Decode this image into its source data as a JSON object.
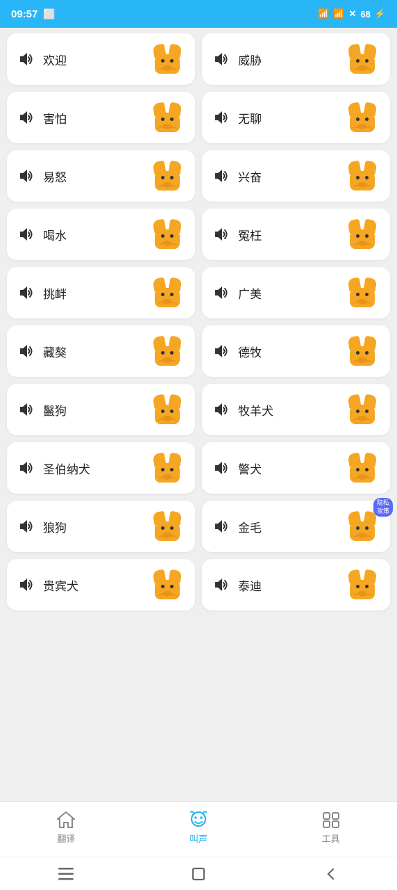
{
  "statusBar": {
    "time": "09:57",
    "icons": [
      "battery",
      "wifi",
      "signal"
    ]
  },
  "cards": [
    {
      "id": 1,
      "label": "欢迎"
    },
    {
      "id": 2,
      "label": "威胁"
    },
    {
      "id": 3,
      "label": "害怕"
    },
    {
      "id": 4,
      "label": "无聊"
    },
    {
      "id": 5,
      "label": "易怒"
    },
    {
      "id": 6,
      "label": "兴奋"
    },
    {
      "id": 7,
      "label": "喝水"
    },
    {
      "id": 8,
      "label": "冤枉"
    },
    {
      "id": 9,
      "label": "挑衅"
    },
    {
      "id": 10,
      "label": "广美"
    },
    {
      "id": 11,
      "label": "藏獒"
    },
    {
      "id": 12,
      "label": "德牧"
    },
    {
      "id": 13,
      "label": "鬣狗"
    },
    {
      "id": 14,
      "label": "牧羊犬"
    },
    {
      "id": 15,
      "label": "圣伯纳犬"
    },
    {
      "id": 16,
      "label": "警犬"
    },
    {
      "id": 17,
      "label": "狼狗"
    },
    {
      "id": 18,
      "label": "金毛",
      "hasBadge": true,
      "badgeText": "隐私\n攻策"
    },
    {
      "id": 19,
      "label": "贵宾犬"
    },
    {
      "id": 20,
      "label": "泰迪"
    }
  ],
  "bottomNav": {
    "items": [
      {
        "id": "translate",
        "label": "翻译",
        "active": false
      },
      {
        "id": "bark",
        "label": "叫声",
        "active": true
      },
      {
        "id": "tools",
        "label": "工具",
        "active": false
      }
    ]
  }
}
